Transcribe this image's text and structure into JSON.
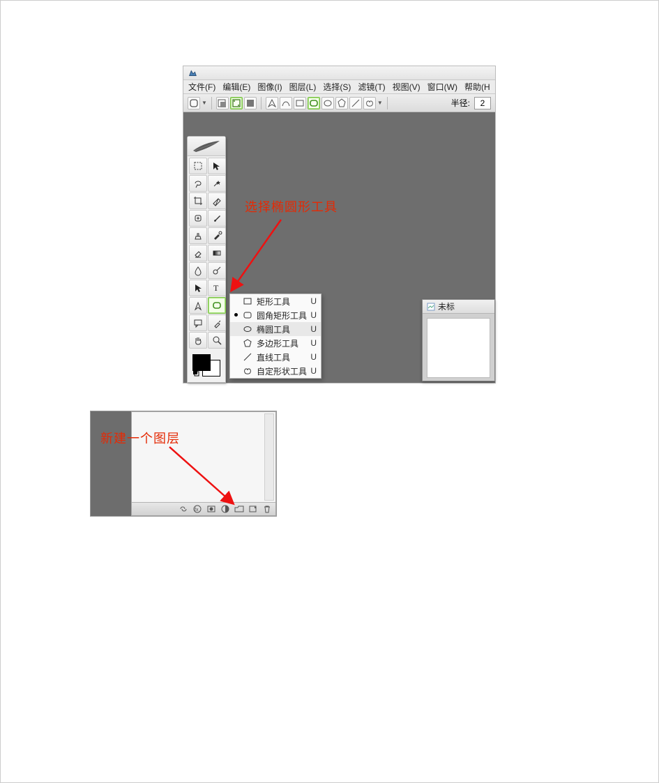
{
  "menubar": {
    "file": "文件(F)",
    "edit": "编辑(E)",
    "image": "图像(I)",
    "layer": "图层(L)",
    "select": "选择(S)",
    "filter": "滤镜(T)",
    "view": "视图(V)",
    "window": "窗口(W)",
    "help": "帮助(H"
  },
  "optionsbar": {
    "radius_label": "半径:",
    "radius_value": "2"
  },
  "tools": {
    "names": [
      "marquee-tool",
      "move-tool",
      "lasso-tool",
      "magic-wand-tool",
      "crop-tool",
      "slice-tool",
      "healing-brush-tool",
      "brush-tool",
      "clone-stamp-tool",
      "history-brush-tool",
      "eraser-tool",
      "gradient-tool",
      "blur-tool",
      "dodge-tool",
      "path-select-tool",
      "type-tool",
      "pen-tool",
      "shape-tool",
      "notes-tool",
      "eyedropper-tool",
      "hand-tool",
      "zoom-tool"
    ]
  },
  "flyout": {
    "items": [
      {
        "label": "矩形工具",
        "shortcut": "U",
        "icon": "rectangle-icon"
      },
      {
        "label": "圆角矩形工具",
        "shortcut": "U",
        "icon": "rounded-rect-icon"
      },
      {
        "label": "椭圆工具",
        "shortcut": "U",
        "icon": "ellipse-icon"
      },
      {
        "label": "多边形工具",
        "shortcut": "U",
        "icon": "polygon-icon"
      },
      {
        "label": "直线工具",
        "shortcut": "U",
        "icon": "line-icon"
      },
      {
        "label": "自定形状工具",
        "shortcut": "U",
        "icon": "custom-shape-icon"
      }
    ],
    "selected_index": 2,
    "marked_index": 1
  },
  "annotations": {
    "select_ellipse": "选择椭圆形工具",
    "new_layer": "新建一个图层"
  },
  "docwin": {
    "title": "未标"
  },
  "layers_bottom_icons": [
    "fx-icon",
    "mask-icon",
    "adjustment-icon",
    "group-icon",
    "new-layer-icon",
    "trash-icon",
    "options-icon"
  ]
}
